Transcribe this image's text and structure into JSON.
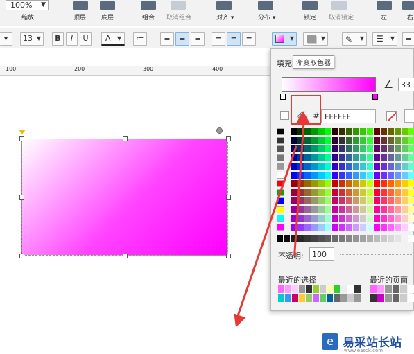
{
  "toolbar": {
    "zoom_value": "100%",
    "zoom_label": "缩放",
    "buttons": [
      {
        "label": "顶层"
      },
      {
        "label": "底层"
      },
      {
        "label": "组合"
      },
      {
        "label": "取消组合"
      },
      {
        "label": "对齐 ▾"
      },
      {
        "label": "分布 ▾"
      },
      {
        "label": "锁定"
      },
      {
        "label": "取消锁定"
      },
      {
        "label": "左"
      },
      {
        "label": "右"
      }
    ]
  },
  "format_bar": {
    "font_size": "13",
    "bold": "B",
    "italic": "I",
    "underline": "U",
    "font_color": "A"
  },
  "ruler": {
    "ticks": [
      "100",
      "200",
      "300",
      "400"
    ]
  },
  "fill_panel": {
    "title": "填充类型",
    "tooltip": "渐变取色器",
    "angle_value": "33",
    "hash_label": "#",
    "hex_value": "FFFFFF",
    "opacity_label": "不透明:",
    "opacity_value": "100",
    "recent_label": "最近的选择",
    "recent_page_label": "最近的页面",
    "colors": {
      "gradient_start": "#ffffff",
      "gradient_end": "#ff00ff",
      "highlight": "#e53935"
    }
  },
  "watermark": {
    "text": "易采站长站",
    "subtext": "www.easck.com"
  }
}
